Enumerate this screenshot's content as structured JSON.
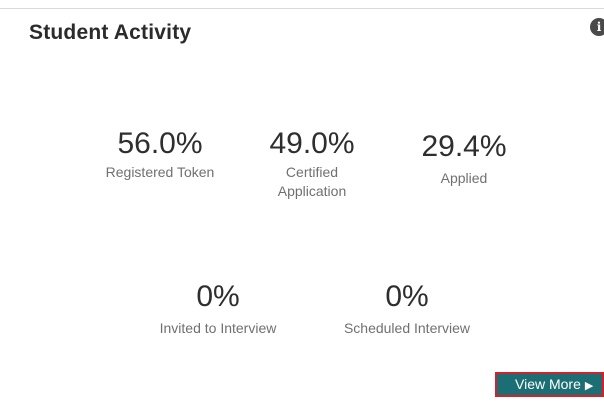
{
  "card": {
    "title": "Student Activity",
    "info_icon": "info-icon",
    "info_glyph": "i"
  },
  "stats": [
    {
      "value": "56.0%",
      "label": "Registered Token"
    },
    {
      "value": "49.0%",
      "label": "Certified Application"
    },
    {
      "value": "29.4%",
      "label": "Applied"
    },
    {
      "value": "0%",
      "label": "Invited to Interview"
    },
    {
      "value": "0%",
      "label": "Scheduled Interview"
    }
  ],
  "view_more": {
    "label": "View More",
    "icon": "play-arrow-icon",
    "glyph": "▶"
  },
  "colors": {
    "button_bg": "#1b6f74",
    "button_border": "#d6202a"
  }
}
